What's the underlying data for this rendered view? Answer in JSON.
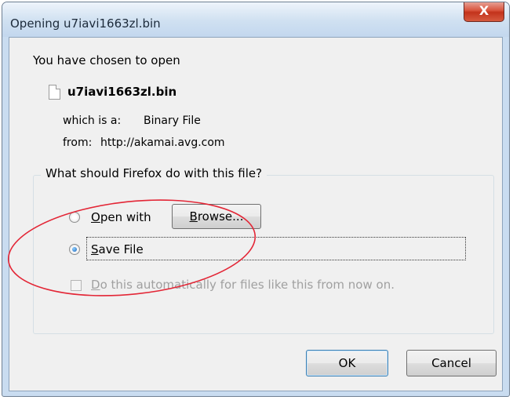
{
  "window": {
    "title": "Opening u7iavi1663zl.bin",
    "close_label": "X"
  },
  "intro": "You have chosen to open",
  "file": {
    "name": "u7iavi1663zl.bin",
    "type_label": "which is a:",
    "type_value": "Binary File",
    "from_label": "from:",
    "from_value": "http://akamai.avg.com"
  },
  "group": {
    "legend": "What should Firefox do with this file?",
    "open_with": {
      "label_key": "O",
      "label_rest": "pen with",
      "selected": false
    },
    "browse": {
      "label_key": "B",
      "label_rest": "rowse..."
    },
    "save_file": {
      "label_key": "S",
      "label_rest": "ave File",
      "selected": true
    },
    "auto": {
      "label_key": "D",
      "label_rest": "o this automatically for files like this from now on.",
      "checked": false,
      "enabled": false
    }
  },
  "buttons": {
    "ok": "OK",
    "cancel": "Cancel"
  },
  "annotation": {
    "color": "#e32636"
  }
}
